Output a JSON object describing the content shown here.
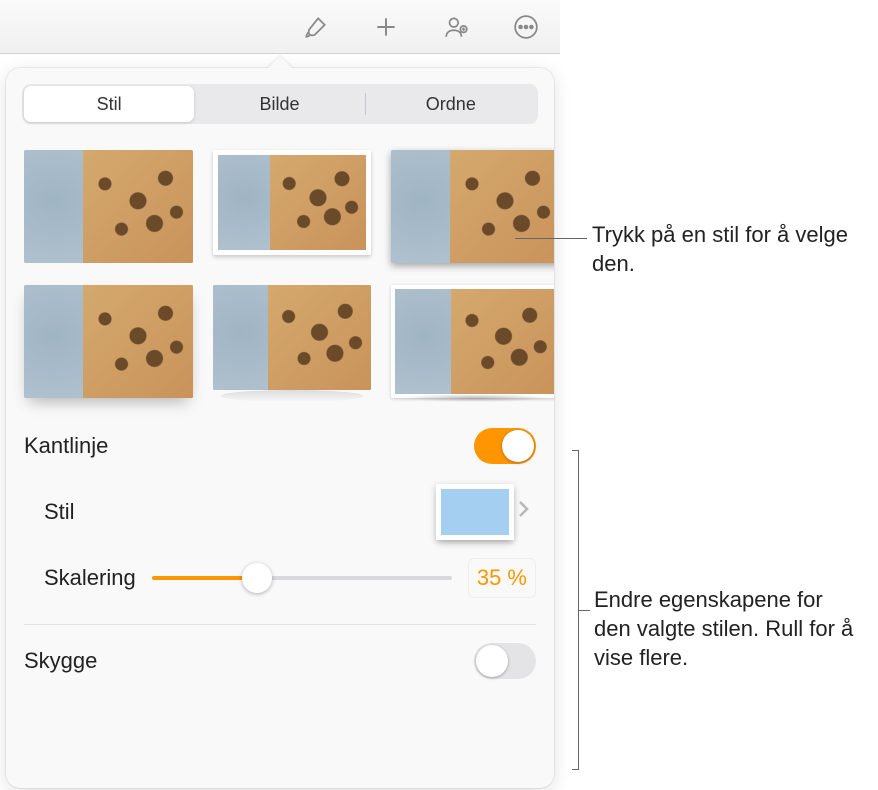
{
  "tabs": {
    "stil": "Stil",
    "bilde": "Bilde",
    "ordne": "Ordne"
  },
  "border": {
    "label": "Kantlinje",
    "on": true
  },
  "style": {
    "label": "Stil"
  },
  "scaling": {
    "label": "Skalering",
    "value": "35 %",
    "percent": 35
  },
  "shadow": {
    "label": "Skygge",
    "on": false
  },
  "callouts": {
    "styleTap": "Trykk på en stil for å velge den.",
    "properties": "Endre egenskapene for den valgte stilen. Rull for å vise flere."
  }
}
